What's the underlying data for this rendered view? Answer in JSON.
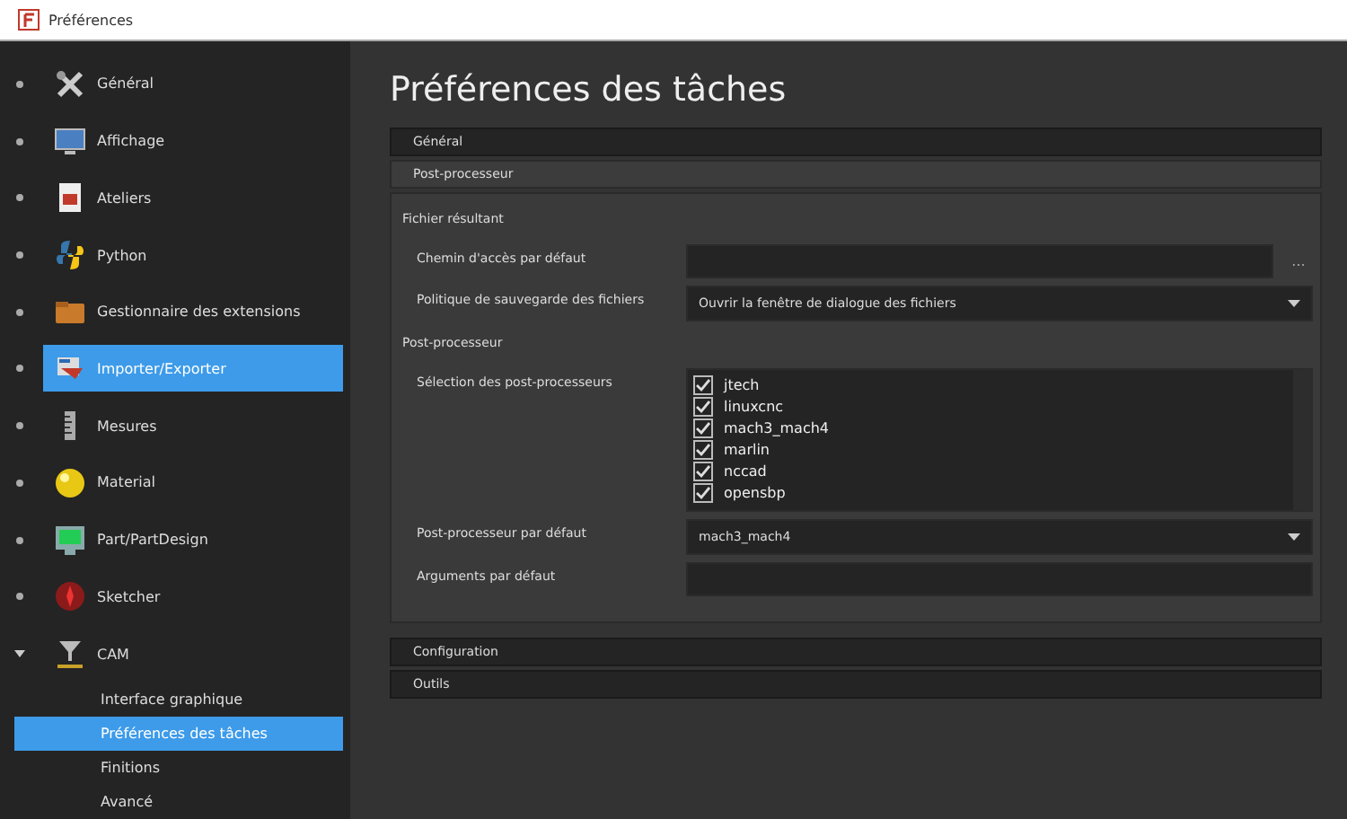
{
  "window": {
    "title": "Préférences"
  },
  "sidebar": {
    "items": [
      {
        "label": "Général",
        "selected": false
      },
      {
        "label": "Affichage",
        "selected": false
      },
      {
        "label": "Ateliers",
        "selected": false
      },
      {
        "label": "Python",
        "selected": false
      },
      {
        "label": "Gestionnaire des extensions",
        "selected": false
      },
      {
        "label": "Importer/Exporter",
        "selected": true
      },
      {
        "label": "Mesures",
        "selected": false
      },
      {
        "label": "Material",
        "selected": false
      },
      {
        "label": "Part/PartDesign",
        "selected": false
      },
      {
        "label": "Sketcher",
        "selected": false
      },
      {
        "label": "CAM",
        "selected": false,
        "expanded": true,
        "children": [
          {
            "label": "Interface graphique",
            "selected": false
          },
          {
            "label": "Préférences des tâches",
            "selected": true
          },
          {
            "label": "Finitions",
            "selected": false
          },
          {
            "label": "Avancé",
            "selected": false
          }
        ]
      }
    ]
  },
  "page": {
    "title": "Préférences des tâches",
    "sections": [
      {
        "label": "Général",
        "expanded": false
      },
      {
        "label": "Post-processeur",
        "expanded": true,
        "groups": [
          {
            "title": "Fichier résultant",
            "rows": [
              {
                "kind": "path",
                "label": "Chemin d'accès par défaut",
                "browse": "..."
              },
              {
                "kind": "combo",
                "label": "Politique de sauvegarde des fichiers",
                "value": "Ouvrir la fenêtre de dialogue des fichiers"
              }
            ]
          },
          {
            "title": "Post-processeur",
            "rows": [
              {
                "kind": "checklist",
                "label": "Sélection des post-processeurs",
                "items": [
                  {
                    "label": "jtech",
                    "checked": true
                  },
                  {
                    "label": "linuxcnc",
                    "checked": true
                  },
                  {
                    "label": "mach3_mach4",
                    "checked": true
                  },
                  {
                    "label": "marlin",
                    "checked": true
                  },
                  {
                    "label": "nccad",
                    "checked": true
                  },
                  {
                    "label": "opensbp",
                    "checked": true
                  }
                ]
              },
              {
                "kind": "combo",
                "label": "Post-processeur par défaut",
                "value": "mach3_mach4"
              },
              {
                "kind": "path",
                "label": "Arguments par défaut"
              }
            ]
          }
        ]
      },
      {
        "label": "Configuration",
        "expanded": false
      },
      {
        "label": "Outils",
        "expanded": false
      }
    ]
  }
}
